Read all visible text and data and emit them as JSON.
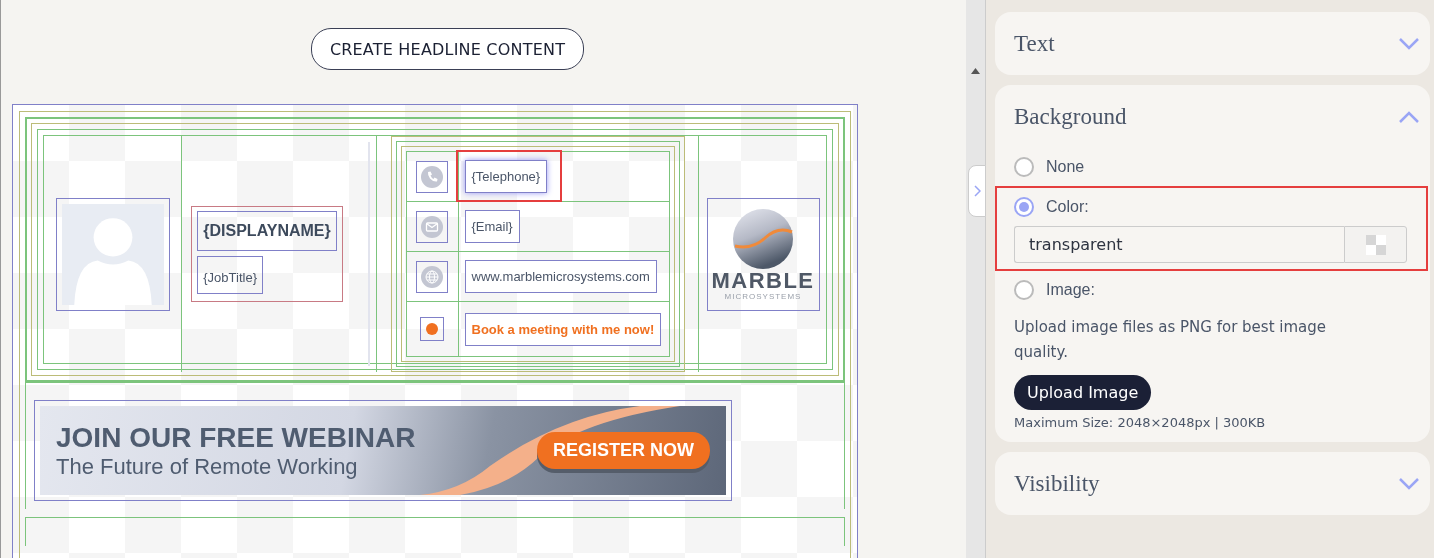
{
  "header_button": "CREATE HEADLINE CONTENT",
  "signature": {
    "display_name": "{DISPLAYNAME}",
    "job_title": "{JobTitle}",
    "contacts": [
      {
        "kind": "phone",
        "text": "{Telephone}",
        "selected": true
      },
      {
        "kind": "email",
        "text": "{Email}",
        "selected": false
      },
      {
        "kind": "web",
        "text": "www.marblemicrosystems.com",
        "selected": false
      },
      {
        "kind": "link",
        "text": "Book a meeting with me now!",
        "selected": false
      }
    ],
    "logo": {
      "name": "MARBLE",
      "tagline": "MICROSYSTEMS"
    }
  },
  "banner": {
    "title": "JOIN OUR FREE WEBINAR",
    "subtitle": "The Future of Remote Working",
    "button": "REGISTER NOW"
  },
  "panel": {
    "sections": [
      {
        "kind": "plain",
        "title": "Text",
        "expanded": false
      },
      {
        "kind": "background",
        "title": "Background",
        "expanded": true,
        "options": [
          {
            "label": "None",
            "selected": false
          },
          {
            "label": "Color:",
            "selected": true
          },
          {
            "label": "Image:",
            "selected": false
          }
        ],
        "color_value": "transparent",
        "hint": "Upload image files as PNG for best image quality.",
        "upload_button": "Upload Image",
        "max_size": "Maximum Size: 2048×2048px | 300KB"
      },
      {
        "kind": "plain",
        "title": "Visibility",
        "expanded": false
      }
    ]
  }
}
